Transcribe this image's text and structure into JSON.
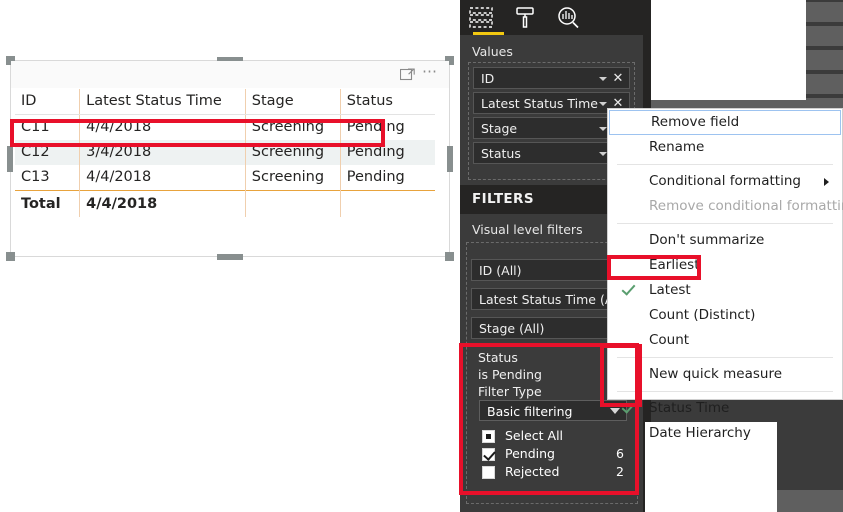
{
  "visual": {
    "focus_icon": "focus-mode-icon",
    "more_options_icon": "more-options-icon",
    "columns": [
      "ID",
      "Latest Status Time",
      "Stage",
      "Status"
    ],
    "rows": [
      {
        "id": "C11",
        "time": "4/4/2018",
        "stage": "Screening",
        "status": "Pending"
      },
      {
        "id": "C12",
        "time": "3/4/2018",
        "stage": "Screening",
        "status": "Pending"
      },
      {
        "id": "C13",
        "time": "4/4/2018",
        "stage": "Screening",
        "status": "Pending"
      }
    ],
    "total": {
      "label": "Total",
      "time": "4/4/2018",
      "stage": "",
      "status": ""
    }
  },
  "visualizations": {
    "tabs": [
      {
        "name": "fields-icon",
        "active": true
      },
      {
        "name": "format-paint-roller-icon",
        "active": false
      },
      {
        "name": "analytics-magnifier-icon",
        "active": false
      }
    ],
    "values_label": "Values",
    "fields": [
      {
        "label": "ID"
      },
      {
        "label": "Latest Status Time"
      },
      {
        "label": "Stage"
      },
      {
        "label": "Status"
      }
    ]
  },
  "filters": {
    "title": "FILTERS",
    "visual_level_label": "Visual level filters",
    "cards": [
      {
        "label": "ID  (All)"
      },
      {
        "label": "Latest Status Time  (All)"
      },
      {
        "label": "Stage  (All)"
      }
    ],
    "expanded": {
      "field": "Status",
      "condition": "is Pending",
      "filter_type_label": "Filter Type",
      "filter_type_value": "Basic filtering",
      "options": [
        {
          "label": "Select All",
          "count": "",
          "state": "partial"
        },
        {
          "label": "Pending",
          "count": "6",
          "state": "checked"
        },
        {
          "label": "Rejected",
          "count": "2",
          "state": "unchecked"
        }
      ]
    }
  },
  "context_menu": {
    "items": [
      {
        "label": "Remove field",
        "selected": true,
        "checked": false,
        "disabled": false,
        "submenu": false
      },
      {
        "label": "Rename",
        "selected": false,
        "checked": false,
        "disabled": false,
        "submenu": false
      },
      {
        "separator": true
      },
      {
        "label": "Conditional formatting",
        "selected": false,
        "checked": false,
        "disabled": false,
        "submenu": true
      },
      {
        "label": "Remove conditional formatting",
        "selected": false,
        "checked": false,
        "disabled": true,
        "submenu": false
      },
      {
        "separator": true
      },
      {
        "label": "Don't summarize",
        "selected": false,
        "checked": false,
        "disabled": false,
        "submenu": false
      },
      {
        "label": "Earliest",
        "selected": false,
        "checked": false,
        "disabled": false,
        "submenu": false
      },
      {
        "label": "Latest",
        "selected": false,
        "checked": true,
        "disabled": false,
        "submenu": false
      },
      {
        "label": "Count (Distinct)",
        "selected": false,
        "checked": false,
        "disabled": false,
        "submenu": false
      },
      {
        "label": "Count",
        "selected": false,
        "checked": false,
        "disabled": false,
        "submenu": false
      },
      {
        "separator": true
      },
      {
        "label": "New quick measure",
        "selected": false,
        "checked": false,
        "disabled": false,
        "submenu": false
      },
      {
        "separator": true
      },
      {
        "label": "Status Time",
        "selected": false,
        "checked": true,
        "disabled": false,
        "submenu": false
      },
      {
        "label": "Date Hierarchy",
        "selected": false,
        "checked": false,
        "disabled": false,
        "submenu": false
      }
    ]
  },
  "colors": {
    "highlight_red": "#e8102a",
    "accent_yellow": "#f2c811",
    "pane_dark": "#3b3b3b",
    "pane_darker": "#252423",
    "check_green": "#5a9e6f",
    "total_rule": "#e8a33d"
  }
}
